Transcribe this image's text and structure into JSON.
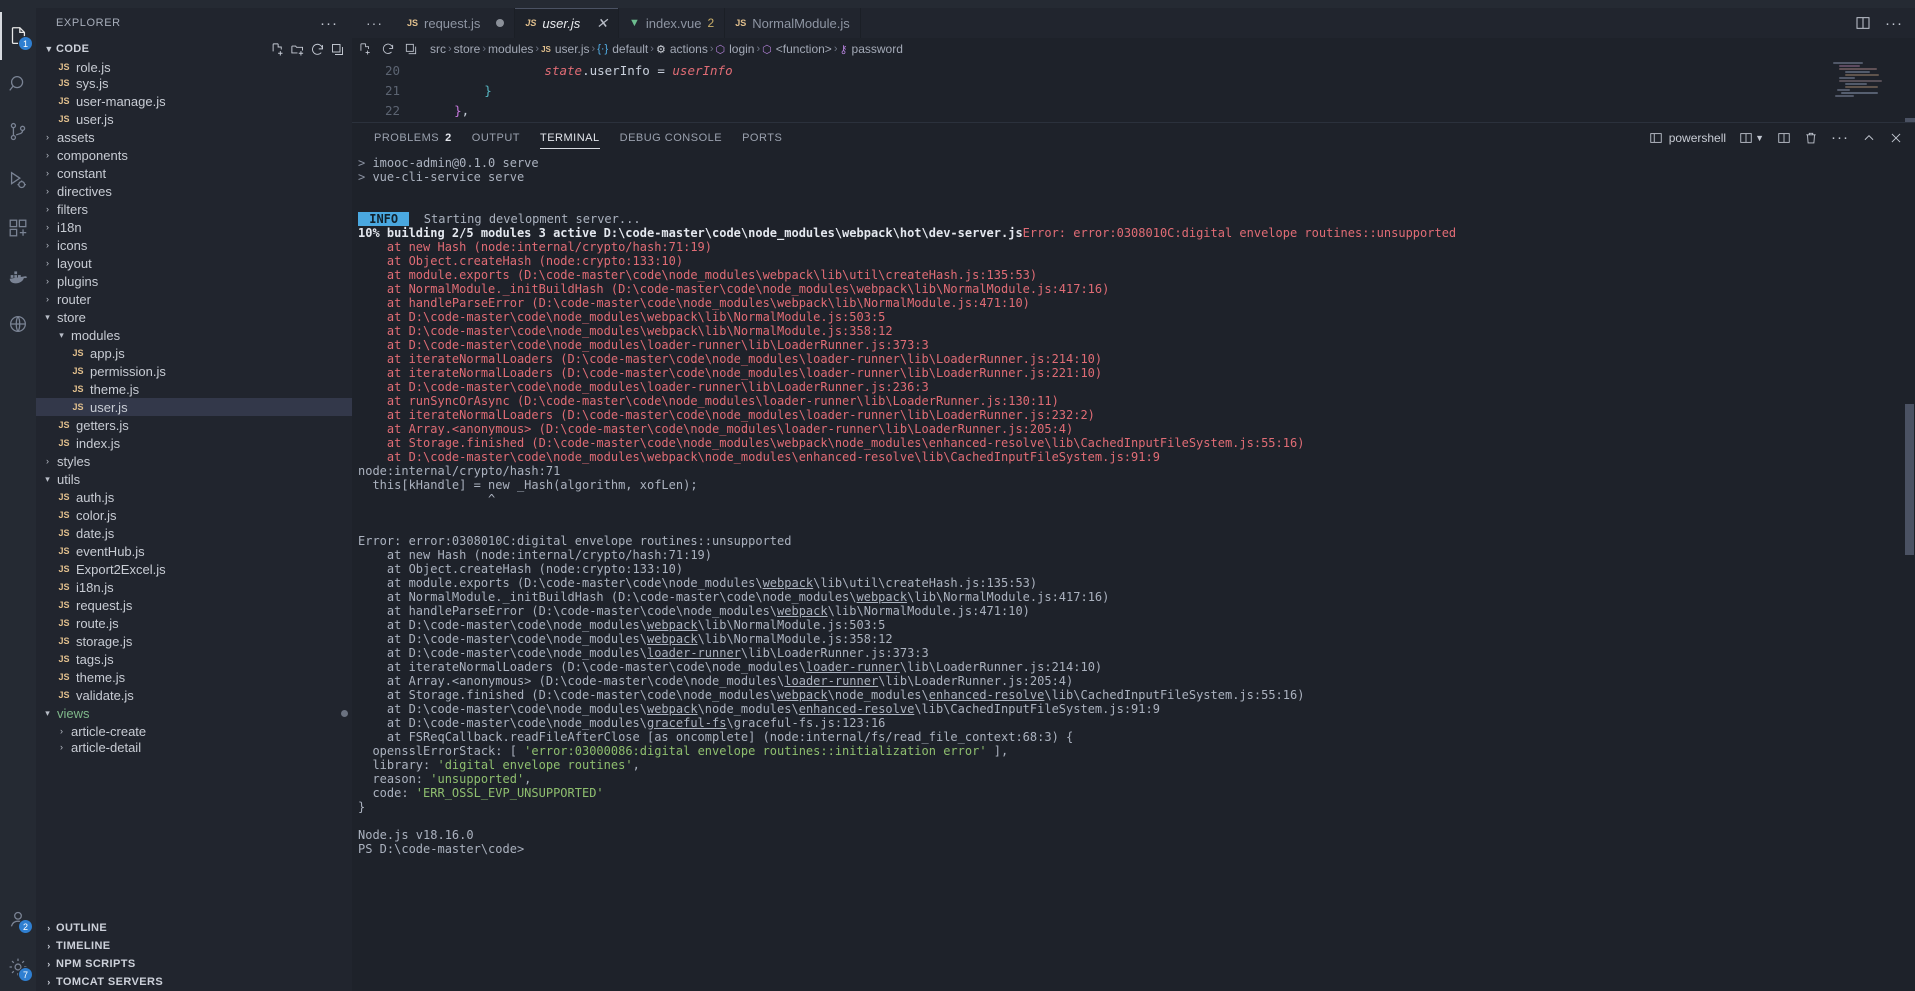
{
  "window": {
    "title": "user.js - code - Visual Studio Code"
  },
  "activitybar": {
    "items": [
      {
        "name": "explorer",
        "icon": "files-icon",
        "badge": "1",
        "active": true
      },
      {
        "name": "search",
        "icon": "search-icon",
        "badge": "",
        "active": false
      },
      {
        "name": "source-control",
        "icon": "source-control-icon",
        "badge": "",
        "active": false
      },
      {
        "name": "run-and-debug",
        "icon": "run-debug-icon",
        "badge": "",
        "active": false
      },
      {
        "name": "extensions",
        "icon": "extensions-icon",
        "badge": "",
        "active": false
      },
      {
        "name": "docker",
        "icon": "docker-icon",
        "badge": "",
        "active": false
      },
      {
        "name": "remote-explorer",
        "icon": "remote-explorer-icon",
        "badge": "",
        "active": false
      }
    ],
    "bottom": [
      {
        "name": "accounts",
        "icon": "account-icon",
        "badge": "2"
      },
      {
        "name": "manage",
        "icon": "gear-icon",
        "badge": "7"
      }
    ]
  },
  "sidebar": {
    "title": "EXPLORER",
    "more_actions": "···",
    "section": {
      "label": "CODE",
      "actions": [
        "new-file-icon",
        "new-folder-icon",
        "refresh-icon",
        "collapse-all-icon"
      ]
    },
    "tree": [
      {
        "label": "role.js",
        "type": "js",
        "depth": 2,
        "clipped": true
      },
      {
        "label": "sys.js",
        "type": "js",
        "depth": 2
      },
      {
        "label": "user-manage.js",
        "type": "js",
        "depth": 2
      },
      {
        "label": "user.js",
        "type": "js",
        "depth": 2
      },
      {
        "label": "assets",
        "type": "folder",
        "depth": 1,
        "expanded": false
      },
      {
        "label": "components",
        "type": "folder",
        "depth": 1,
        "expanded": false
      },
      {
        "label": "constant",
        "type": "folder",
        "depth": 1,
        "expanded": false
      },
      {
        "label": "directives",
        "type": "folder",
        "depth": 1,
        "expanded": false
      },
      {
        "label": "filters",
        "type": "folder",
        "depth": 1,
        "expanded": false
      },
      {
        "label": "i18n",
        "type": "folder",
        "depth": 1,
        "expanded": false
      },
      {
        "label": "icons",
        "type": "folder",
        "depth": 1,
        "expanded": false
      },
      {
        "label": "layout",
        "type": "folder",
        "depth": 1,
        "expanded": false
      },
      {
        "label": "plugins",
        "type": "folder",
        "depth": 1,
        "expanded": false
      },
      {
        "label": "router",
        "type": "folder",
        "depth": 1,
        "expanded": false
      },
      {
        "label": "store",
        "type": "folder",
        "depth": 1,
        "expanded": true
      },
      {
        "label": "modules",
        "type": "folder",
        "depth": 2,
        "expanded": true
      },
      {
        "label": "app.js",
        "type": "js",
        "depth": 3
      },
      {
        "label": "permission.js",
        "type": "js",
        "depth": 3
      },
      {
        "label": "theme.js",
        "type": "js",
        "depth": 3
      },
      {
        "label": "user.js",
        "type": "js",
        "depth": 3,
        "selected": true
      },
      {
        "label": "getters.js",
        "type": "js",
        "depth": 2
      },
      {
        "label": "index.js",
        "type": "js",
        "depth": 2
      },
      {
        "label": "styles",
        "type": "folder",
        "depth": 1,
        "expanded": false
      },
      {
        "label": "utils",
        "type": "folder",
        "depth": 1,
        "expanded": true
      },
      {
        "label": "auth.js",
        "type": "js",
        "depth": 2
      },
      {
        "label": "color.js",
        "type": "js",
        "depth": 2
      },
      {
        "label": "date.js",
        "type": "js",
        "depth": 2
      },
      {
        "label": "eventHub.js",
        "type": "js",
        "depth": 2
      },
      {
        "label": "Export2Excel.js",
        "type": "js",
        "depth": 2
      },
      {
        "label": "i18n.js",
        "type": "js",
        "depth": 2
      },
      {
        "label": "request.js",
        "type": "js",
        "depth": 2
      },
      {
        "label": "route.js",
        "type": "js",
        "depth": 2
      },
      {
        "label": "storage.js",
        "type": "js",
        "depth": 2
      },
      {
        "label": "tags.js",
        "type": "js",
        "depth": 2
      },
      {
        "label": "theme.js",
        "type": "js",
        "depth": 2
      },
      {
        "label": "validate.js",
        "type": "js",
        "depth": 2
      },
      {
        "label": "views",
        "type": "folder",
        "depth": 1,
        "expanded": true,
        "green": true,
        "modified": true
      },
      {
        "label": "article-create",
        "type": "folder",
        "depth": 2,
        "expanded": false
      },
      {
        "label": "article-detail",
        "type": "folder",
        "depth": 2,
        "expanded": false,
        "clipped": true
      }
    ],
    "bottom_panels": [
      {
        "label": "OUTLINE"
      },
      {
        "label": "TIMELINE"
      },
      {
        "label": "NPM SCRIPTS"
      },
      {
        "label": "TOMCAT SERVERS"
      }
    ]
  },
  "tabs": {
    "overflow_dots": "···",
    "items": [
      {
        "label": "request.js",
        "icon": "js-file-icon",
        "modified": true,
        "active": false
      },
      {
        "label": "user.js",
        "icon": "js-file-icon",
        "active": true,
        "closable": true
      },
      {
        "label": "index.vue",
        "icon": "vue-file-icon",
        "count": "2",
        "active": false
      },
      {
        "label": "NormalModule.js",
        "icon": "js-file-icon",
        "active": false
      }
    ],
    "right_actions": [
      "split-editor-icon",
      "more-actions-icon"
    ]
  },
  "breadcrumb": {
    "actions": [
      "new-file-icon",
      "refresh-icon",
      "collapse-all-icon"
    ],
    "items": [
      {
        "label": "src",
        "icon": ""
      },
      {
        "label": "store",
        "icon": ""
      },
      {
        "label": "modules",
        "icon": ""
      },
      {
        "label": "user.js",
        "icon": "js-file-icon"
      },
      {
        "label": "default",
        "icon": "symbol-object-icon"
      },
      {
        "label": "actions",
        "icon": "symbol-method-icon"
      },
      {
        "label": "login",
        "icon": "symbol-field-icon"
      },
      {
        "label": "<function>",
        "icon": "symbol-field-icon"
      },
      {
        "label": "password",
        "icon": "symbol-key-icon"
      }
    ],
    "separator": "›"
  },
  "editor": {
    "lines": [
      {
        "number": "20",
        "indent": 8,
        "tokens": [
          {
            "t": "state",
            "c": "red-italic"
          },
          {
            "t": ".",
            "c": "white"
          },
          {
            "t": "userInfo",
            "c": "white"
          },
          {
            "t": " ",
            "c": "white"
          },
          {
            "t": "=",
            "c": "white"
          },
          {
            "t": " ",
            "c": "white"
          },
          {
            "t": "userInfo",
            "c": "red-italic"
          }
        ]
      },
      {
        "number": "21",
        "indent": 4,
        "tokens": [
          {
            "t": "}",
            "c": "cyan"
          }
        ]
      },
      {
        "number": "22",
        "indent": 2,
        "tokens": [
          {
            "t": "}",
            "c": "purple"
          },
          {
            "t": ",",
            "c": "white"
          }
        ]
      }
    ]
  },
  "panel": {
    "tabs": [
      {
        "label": "PROBLEMS",
        "badge": "2",
        "active": false
      },
      {
        "label": "OUTPUT",
        "badge": "",
        "active": false
      },
      {
        "label": "TERMINAL",
        "badge": "",
        "active": true
      },
      {
        "label": "DEBUG CONSOLE",
        "badge": "",
        "active": false
      },
      {
        "label": "PORTS",
        "badge": "",
        "active": false
      }
    ],
    "shell": {
      "label": "powershell",
      "icon": "terminal-icon"
    },
    "actions": [
      "split-terminal-icon",
      "launch-profile-chevron-icon",
      "split-panel-icon",
      "kill-terminal-icon",
      "more-actions-icon",
      "maximize-panel-icon",
      "close-panel-icon"
    ]
  },
  "terminal": {
    "lines": [
      {
        "segs": [
          {
            "t": "> ",
            "c": "dim"
          },
          {
            "t": "imooc-admin@0.1.0 serve",
            "c": "gray"
          }
        ]
      },
      {
        "segs": [
          {
            "t": "> ",
            "c": "dim"
          },
          {
            "t": "vue-cli-service serve",
            "c": "gray"
          }
        ]
      },
      {
        "segs": []
      },
      {
        "segs": []
      },
      {
        "segs": [
          {
            "t": " INFO ",
            "c": "info"
          },
          {
            "t": "  Starting development server...",
            "c": "gray"
          }
        ]
      },
      {
        "segs": [
          {
            "t": "10% building 2/5 modules 3 active D:\\code-master\\code\\node_modules\\webpack\\hot\\dev-server.js",
            "c": "bold"
          },
          {
            "t": "Error: error:0308010C:digital envelope routines::unsupported",
            "c": "red"
          }
        ]
      },
      {
        "segs": [
          {
            "t": "    at new Hash (node:internal/crypto/hash:71:19)",
            "c": "red"
          }
        ]
      },
      {
        "segs": [
          {
            "t": "    at Object.createHash (node:crypto:133:10)",
            "c": "red"
          }
        ]
      },
      {
        "segs": [
          {
            "t": "    at module.exports (D:\\code-master\\code\\node_modules\\webpack\\lib\\util\\createHash.js:135:53)",
            "c": "red"
          }
        ]
      },
      {
        "segs": [
          {
            "t": "    at NormalModule._initBuildHash (D:\\code-master\\code\\node_modules\\webpack\\lib\\NormalModule.js:417:16)",
            "c": "red"
          }
        ]
      },
      {
        "segs": [
          {
            "t": "    at handleParseError (D:\\code-master\\code\\node_modules\\webpack\\lib\\NormalModule.js:471:10)",
            "c": "red"
          }
        ]
      },
      {
        "segs": [
          {
            "t": "    at D:\\code-master\\code\\node_modules\\webpack\\lib\\NormalModule.js:503:5",
            "c": "red"
          }
        ]
      },
      {
        "segs": [
          {
            "t": "    at D:\\code-master\\code\\node_modules\\webpack\\lib\\NormalModule.js:358:12",
            "c": "red"
          }
        ]
      },
      {
        "segs": [
          {
            "t": "    at D:\\code-master\\code\\node_modules\\loader-runner\\lib\\LoaderRunner.js:373:3",
            "c": "red"
          }
        ]
      },
      {
        "segs": [
          {
            "t": "    at iterateNormalLoaders (D:\\code-master\\code\\node_modules\\loader-runner\\lib\\LoaderRunner.js:214:10)",
            "c": "red"
          }
        ]
      },
      {
        "segs": [
          {
            "t": "    at iterateNormalLoaders (D:\\code-master\\code\\node_modules\\loader-runner\\lib\\LoaderRunner.js:221:10)",
            "c": "red"
          }
        ]
      },
      {
        "segs": [
          {
            "t": "    at D:\\code-master\\code\\node_modules\\loader-runner\\lib\\LoaderRunner.js:236:3",
            "c": "red"
          }
        ]
      },
      {
        "segs": [
          {
            "t": "    at runSyncOrAsync (D:\\code-master\\code\\node_modules\\loader-runner\\lib\\LoaderRunner.js:130:11)",
            "c": "red"
          }
        ]
      },
      {
        "segs": [
          {
            "t": "    at iterateNormalLoaders (D:\\code-master\\code\\node_modules\\loader-runner\\lib\\LoaderRunner.js:232:2)",
            "c": "red"
          }
        ]
      },
      {
        "segs": [
          {
            "t": "    at Array.<anonymous> (D:\\code-master\\code\\node_modules\\loader-runner\\lib\\LoaderRunner.js:205:4)",
            "c": "red"
          }
        ]
      },
      {
        "segs": [
          {
            "t": "    at Storage.finished (D:\\code-master\\code\\node_modules\\webpack\\node_modules\\enhanced-resolve\\lib\\CachedInputFileSystem.js:55:16)",
            "c": "red"
          }
        ]
      },
      {
        "segs": [
          {
            "t": "    at D:\\code-master\\code\\node_modules\\webpack\\node_modules\\enhanced-resolve\\lib\\CachedInputFileSystem.js:91:9",
            "c": "red"
          }
        ]
      },
      {
        "segs": [
          {
            "t": "node:internal/crypto/hash:71",
            "c": "gray"
          }
        ]
      },
      {
        "segs": [
          {
            "t": "  this[kHandle] = new _Hash(algorithm, xofLen);",
            "c": "gray"
          }
        ]
      },
      {
        "segs": [
          {
            "t": "                  ^",
            "c": "gray"
          }
        ]
      },
      {
        "segs": []
      },
      {
        "segs": []
      },
      {
        "segs": [
          {
            "t": "Error: error:0308010C:digital envelope routines::unsupported",
            "c": "gray"
          }
        ]
      },
      {
        "segs": [
          {
            "t": "    at new Hash (node:internal/crypto/hash:71:19)",
            "c": "gray"
          }
        ]
      },
      {
        "segs": [
          {
            "t": "    at Object.createHash (node:crypto:133:10)",
            "c": "gray"
          }
        ]
      },
      {
        "segs": [
          {
            "t": "    at module.exports (D:\\code-master\\code\\node_modules\\webpack\\lib\\util\\createHash.js:135:53)",
            "c": "gray",
            "links": [
              "webpack"
            ]
          }
        ]
      },
      {
        "segs": [
          {
            "t": "    at NormalModule._initBuildHash (D:\\code-master\\code\\node_modules\\webpack\\lib\\NormalModule.js:417:16)",
            "c": "gray",
            "links": [
              "webpack"
            ]
          }
        ]
      },
      {
        "segs": [
          {
            "t": "    at handleParseError (D:\\code-master\\code\\node_modules\\webpack\\lib\\NormalModule.js:471:10)",
            "c": "gray",
            "links": [
              "webpack"
            ]
          }
        ]
      },
      {
        "segs": [
          {
            "t": "    at D:\\code-master\\code\\node_modules\\webpack\\lib\\NormalModule.js:503:5",
            "c": "gray",
            "links": [
              "webpack"
            ]
          }
        ]
      },
      {
        "segs": [
          {
            "t": "    at D:\\code-master\\code\\node_modules\\webpack\\lib\\NormalModule.js:358:12",
            "c": "gray",
            "links": [
              "webpack"
            ]
          }
        ]
      },
      {
        "segs": [
          {
            "t": "    at D:\\code-master\\code\\node_modules\\loader-runner\\lib\\LoaderRunner.js:373:3",
            "c": "gray",
            "links": [
              "loader-runner"
            ]
          }
        ]
      },
      {
        "segs": [
          {
            "t": "    at iterateNormalLoaders (D:\\code-master\\code\\node_modules\\loader-runner\\lib\\LoaderRunner.js:214:10)",
            "c": "gray",
            "links": [
              "loader-runner"
            ]
          }
        ]
      },
      {
        "segs": [
          {
            "t": "    at Array.<anonymous> (D:\\code-master\\code\\node_modules\\loader-runner\\lib\\LoaderRunner.js:205:4)",
            "c": "gray",
            "links": [
              "loader-runner"
            ]
          }
        ]
      },
      {
        "segs": [
          {
            "t": "    at Storage.finished (D:\\code-master\\code\\node_modules\\webpack\\node_modules\\enhanced-resolve\\lib\\CachedInputFileSystem.js:55:16)",
            "c": "gray",
            "links": [
              "webpack",
              "enhanced-resolve"
            ]
          }
        ]
      },
      {
        "segs": [
          {
            "t": "    at D:\\code-master\\code\\node_modules\\webpack\\node_modules\\enhanced-resolve\\lib\\CachedInputFileSystem.js:91:9",
            "c": "gray",
            "links": [
              "webpack",
              "enhanced-resolve"
            ]
          }
        ]
      },
      {
        "segs": [
          {
            "t": "    at D:\\code-master\\code\\node_modules\\graceful-fs\\graceful-fs.js:123:16",
            "c": "gray",
            "links": [
              "graceful-fs"
            ]
          }
        ]
      },
      {
        "segs": [
          {
            "t": "    at FSReqCallback.readFileAfterClose [as oncomplete] (node:internal/fs/read_file_context:68:3) {",
            "c": "gray"
          }
        ]
      },
      {
        "segs": [
          {
            "t": "  opensslErrorStack: [ ",
            "c": "gray"
          },
          {
            "t": "'error:03000086:digital envelope routines::initialization error'",
            "c": "green"
          },
          {
            "t": " ],",
            "c": "gray"
          }
        ]
      },
      {
        "segs": [
          {
            "t": "  library: ",
            "c": "gray"
          },
          {
            "t": "'digital envelope routines'",
            "c": "green"
          },
          {
            "t": ",",
            "c": "gray"
          }
        ]
      },
      {
        "segs": [
          {
            "t": "  reason: ",
            "c": "gray"
          },
          {
            "t": "'unsupported'",
            "c": "green"
          },
          {
            "t": ",",
            "c": "gray"
          }
        ]
      },
      {
        "segs": [
          {
            "t": "  code: ",
            "c": "gray"
          },
          {
            "t": "'ERR_OSSL_EVP_UNSUPPORTED'",
            "c": "green"
          }
        ]
      },
      {
        "segs": [
          {
            "t": "}",
            "c": "gray"
          }
        ]
      },
      {
        "segs": []
      },
      {
        "segs": [
          {
            "t": "Node.js v18.16.0",
            "c": "gray"
          }
        ]
      },
      {
        "segs": [
          {
            "t": "PS D:\\code-master\\code>",
            "c": "gray"
          }
        ]
      }
    ]
  },
  "colors": {
    "accent": "#2f7fd1",
    "editor_bg": "#1e222a",
    "sidebar_bg": "#21252e",
    "activitybar_bg": "#252a33",
    "error_red": "#e06c75",
    "string_green": "#8fbf6f",
    "info_badge": "#4aa8e0",
    "js_yellow": "#e2c08d",
    "vue_green": "#6dbd8f"
  }
}
